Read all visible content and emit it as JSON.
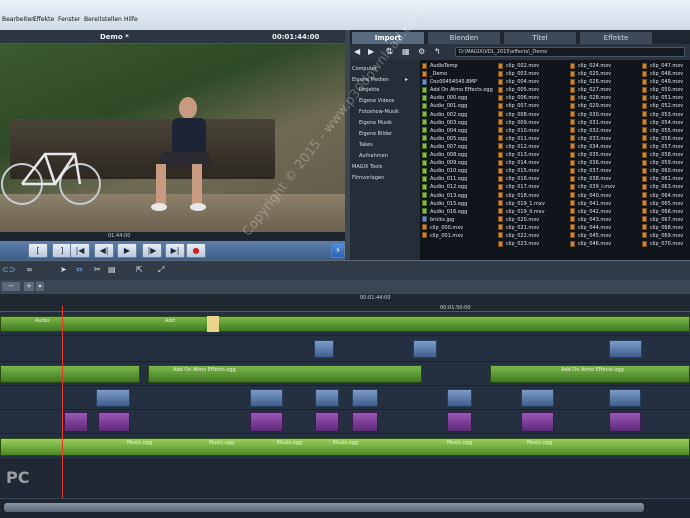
{
  "menu": [
    "Bearbeiten",
    "Effekte",
    "Fenster",
    "Bereitstellen",
    "Hilfe"
  ],
  "preview": {
    "title": "Demo *",
    "timecode": "00:01:44:00",
    "position": "01:44:00"
  },
  "media_tabs": [
    "Import",
    "Blenden",
    "Titel",
    "Effekte"
  ],
  "path": "D:\\MAGIX\\VDL_2015\\effects\\_Demo",
  "tree": [
    "Computer",
    "Eigene Medien",
    "Projekte",
    "Eigene Videos",
    "Fotoshow-Musik",
    "Eigene Musik",
    "Eigene Bilder",
    "Takes",
    "Aufnahmen",
    "MAGIX Tools",
    "Filmvorlagen"
  ],
  "files": [
    [
      "AudioTemp",
      "_Demo",
      "Dsc00454545.BMP",
      "Add On Atmo Effects.ogg",
      "Audio_000.ogg",
      "Audio_001.ogg",
      "Audio_002.ogg",
      "Audio_003.ogg",
      "Audio_004.ogg",
      "Audio_005.ogg",
      "Audio_007.ogg",
      "Audio_008.ogg",
      "Audio_009.ogg",
      "Audio_010.ogg",
      "Audio_011.ogg",
      "Audio_012.ogg",
      "Audio_013.ogg",
      "Audio_015.ogg",
      "Audio_016.ogg",
      "bricks.jpg",
      "clip_000.mxv",
      "clip_001.mxv"
    ],
    [
      "clip_002.mxv",
      "clip_003.mxv",
      "clip_004.mxv",
      "clip_005.mxv",
      "clip_006.mxv",
      "clip_007.mxv",
      "clip_008.mxv",
      "clip_009.mxv",
      "clip_010.mxv",
      "clip_011.mxv",
      "clip_012.mxv",
      "clip_013.mxv",
      "clip_014.mxv",
      "clip_015.mxv",
      "clip_016.mxv",
      "clip_017.mxv",
      "clip_018.mxv",
      "clip_019_1.mxv",
      "clip_019_II.mxv",
      "clip_020.mxv",
      "clip_021.mxv",
      "clip_022.mxv",
      "clip_023.mxv"
    ],
    [
      "clip_024.mxv",
      "clip_025.mxv",
      "clip_026.mxv",
      "clip_027.mxv",
      "clip_028.mxv",
      "clip_029.mxv",
      "clip_030.mxv",
      "clip_031.mxv",
      "clip_032.mxv",
      "clip_033.mxv",
      "clip_034.mxv",
      "clip_035.mxv",
      "clip_036.mxv",
      "clip_037.mxv",
      "clip_038.mxv",
      "clip_039_I.mxv",
      "clip_040.mxv",
      "clip_041.mxv",
      "clip_042.mxv",
      "clip_043.mxv",
      "clip_044.mxv",
      "clip_045.mxv",
      "clip_046.mxv"
    ],
    [
      "clip_047.mxv",
      "clip_048.mxv",
      "clip_049.mxv",
      "clip_050.mxv",
      "clip_051.mxv",
      "clip_052.mxv",
      "clip_053.mxv",
      "clip_054.mxv",
      "clip_055.mxv",
      "clip_056.mxv",
      "clip_057.mxv",
      "clip_058.mxv",
      "clip_059.mxv",
      "clip_060.mxv",
      "clip_061.mxv",
      "clip_063.mxv",
      "clip_064.mxv",
      "clip_065.mxv",
      "clip_066.mxv",
      "clip_067.mxv",
      "clip_068.mxv",
      "clip_069.mxv",
      "clip_070.mxv"
    ]
  ],
  "ruler": {
    "mark1": "00:01:44:00",
    "mark2": "00:01:50:00"
  },
  "clip_labels": {
    "audio": "Audio",
    "add": "Add",
    "atmo": "Add On Atmo Effects.ogg",
    "music": "Music.ogg"
  },
  "watermark": "Copyright © 2015 - www.p30download.com",
  "logo": "PC",
  "colors": {
    "accent": "#3b5e8a",
    "clip_audio": "#7bb84a",
    "clip_video": "#7e9cc8",
    "clip_title": "#9a56b6",
    "playhead": "#e83a2a"
  }
}
